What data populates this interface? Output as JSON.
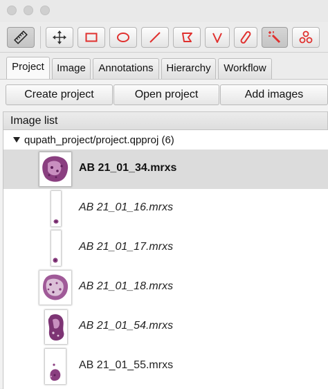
{
  "toolbar": {
    "tools": [
      {
        "icon": "ruler-icon"
      },
      {
        "icon": "move-icon"
      },
      {
        "icon": "rectangle-icon"
      },
      {
        "icon": "ellipse-icon"
      },
      {
        "icon": "line-icon"
      },
      {
        "icon": "polygon-icon"
      },
      {
        "icon": "polyline-icon"
      },
      {
        "icon": "brush-icon"
      },
      {
        "icon": "wand-icon"
      },
      {
        "icon": "points-icon"
      }
    ],
    "tool_color": "#e0302e"
  },
  "tabs": [
    {
      "label": "Project",
      "active": true
    },
    {
      "label": "Image"
    },
    {
      "label": "Annotations"
    },
    {
      "label": "Hierarchy"
    },
    {
      "label": "Workflow"
    }
  ],
  "actions": {
    "create": "Create project",
    "open": "Open project",
    "add": "Add images"
  },
  "image_list": {
    "header": "Image list",
    "project_name": "qupath_project/project.qpproj (6)",
    "items": [
      {
        "name": "AB 21_01_34.mrxs",
        "selected": true
      },
      {
        "name": "AB 21_01_16.mrxs"
      },
      {
        "name": "AB 21_01_17.mrxs"
      },
      {
        "name": "AB 21_01_18.mrxs"
      },
      {
        "name": "AB 21_01_54.mrxs"
      },
      {
        "name": "AB 21_01_55.mrxs"
      }
    ]
  },
  "colors": {
    "tissue": "#8a3f80",
    "tissue_dark": "#5e1f5a",
    "tissue_light": "#c88fc0"
  }
}
